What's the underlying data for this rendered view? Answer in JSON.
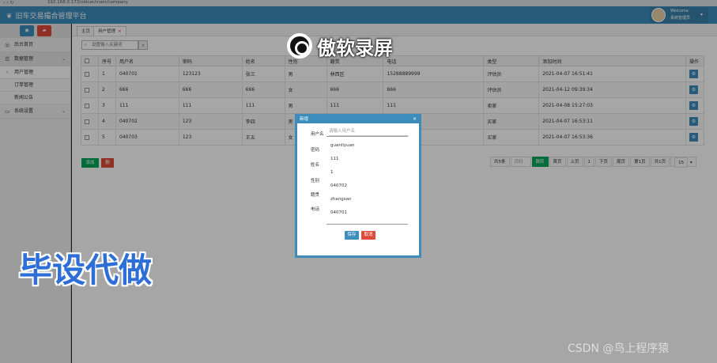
{
  "browser": {
    "nav": "‹  ›  ↻",
    "url": "192.168.0.173/oldcar/main/company"
  },
  "header": {
    "title": "旧车交易撮合管理平台",
    "welcome": "Welcome",
    "role": "系统管理员"
  },
  "sidebar": {
    "items": [
      {
        "label": "后台首页",
        "icon": "dashboard-icon"
      },
      {
        "label": "数据管理",
        "icon": "list-icon"
      },
      {
        "label": "用户管理"
      },
      {
        "label": "订单管理"
      },
      {
        "label": "新闻公告"
      },
      {
        "label": "系统设置",
        "icon": "monitor-icon"
      }
    ]
  },
  "tabs": [
    {
      "label": "主页"
    },
    {
      "label": "用户管理"
    }
  ],
  "search": {
    "placeholder": "设置输入关键词"
  },
  "table": {
    "headers": [
      "序号",
      "用户名",
      "密码",
      "姓名",
      "性别",
      "籍贯",
      "电话",
      "类型",
      "添加时间",
      "操作"
    ],
    "rows": [
      [
        "1",
        "040701",
        "123123",
        "张三",
        "男",
        "林西区",
        "15288889999",
        "评估员",
        "2021-04-07 16:51:41"
      ],
      [
        "2",
        "666",
        "666",
        "666",
        "女",
        "666",
        "666",
        "评估员",
        "2021-04-12 09:39:34"
      ],
      [
        "3",
        "111",
        "111",
        "111",
        "男",
        "111",
        "111",
        "卖家",
        "2021-04-08 15:27:03"
      ],
      [
        "4",
        "040702",
        "123",
        "李四",
        "男",
        "",
        "",
        "买家",
        "2021-04-07 16:53:11"
      ],
      [
        "5",
        "040703",
        "123",
        "王五",
        "女",
        "",
        "",
        "买家",
        "2021-04-07 16:53:36"
      ]
    ]
  },
  "actions": {
    "add": "添加",
    "delete": "删"
  },
  "pager": {
    "total": "共5条",
    "page_input": "页码",
    "go": "跳转",
    "first": "首页",
    "prev": "上页",
    "current": "1",
    "next": "下页",
    "last": "尾页",
    "page_of": "第1页",
    "pages": "共1页",
    "size": "15"
  },
  "modal": {
    "title": "新增",
    "close": "×",
    "labels": [
      "用户名",
      "密码",
      "姓名",
      "性别",
      "籍贯",
      "电话"
    ],
    "username_placeholder": "请输入用户名",
    "values": [
      "guanliyuan",
      "111",
      "1",
      "040702",
      "zhangsan",
      "040701"
    ],
    "save": "保存",
    "cancel": "取消"
  },
  "watermarks": {
    "recorder": "傲软录屏",
    "promo": "毕设代做",
    "csdn": "CSDN @鸟上程序猿"
  }
}
